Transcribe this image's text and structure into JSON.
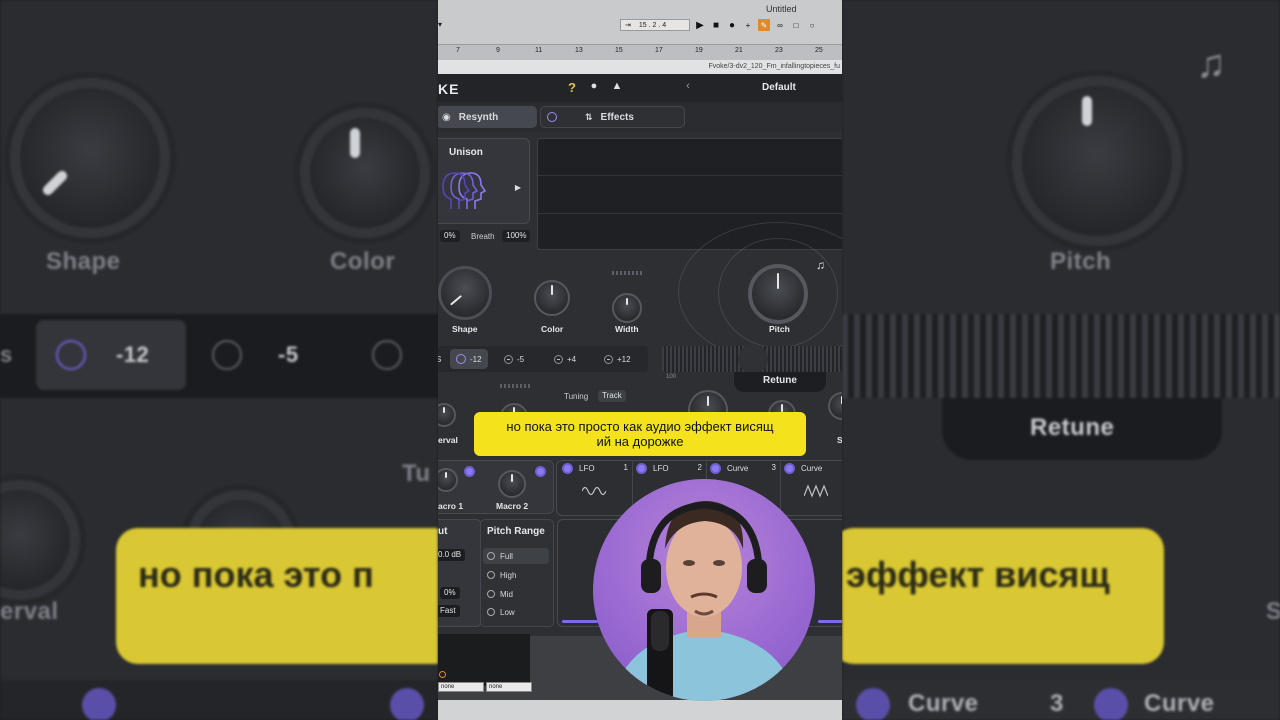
{
  "daw": {
    "title": "Untitled",
    "position": "15 . 2 . 4",
    "ruler_marks": [
      "7",
      "9",
      "11",
      "13",
      "15",
      "17",
      "19",
      "21",
      "23",
      "25"
    ],
    "file_path": "Fvoke/3-dv2_120_Fm_infallingtopieces_fu"
  },
  "plugin": {
    "logo": "KE",
    "help": "?",
    "preset": "Default",
    "tabs": {
      "resynth": "Resynth",
      "effects": "Effects"
    },
    "unison": {
      "title": "Unison",
      "value_left": "0%",
      "breath_label": "Breath",
      "breath_value": "100%"
    },
    "knobs": {
      "shape": "Shape",
      "color": "Color",
      "width": "Width",
      "pitch": "Pitch"
    },
    "intervals": {
      "sel": "-12",
      "i2": "-5",
      "i3": "+4",
      "i4": "+12"
    },
    "tuning_label": "Tuning",
    "tuning_value": "Track",
    "retune": "Retune",
    "slider_min": "100",
    "interval_partial": "erval",
    "s_partial": "S",
    "macros": {
      "m1": "acro 1",
      "m2": "Macro 2"
    },
    "mod_slots": [
      {
        "name": "LFO",
        "num": "1"
      },
      {
        "name": "LFO",
        "num": "2"
      },
      {
        "name": "Curve",
        "num": "3"
      },
      {
        "name": "Curve",
        "num": ""
      }
    ],
    "left_partial": {
      "ut": "ut",
      "db": "0.0 dB",
      "pct": "0%",
      "fast": "Fast"
    },
    "pitch_range": {
      "title": "Pitch Range",
      "options": [
        "Full",
        "High",
        "Mid",
        "Low"
      ],
      "selected": "Full"
    },
    "bottom_selects": [
      "none",
      "none"
    ]
  },
  "subtitle": {
    "line1": "но пока это просто как аудио эффект висящ",
    "line2": "ий на дорожке"
  },
  "background": {
    "left": {
      "shape": "Shape",
      "color": "Color",
      "interval_neg12": "-12",
      "interval_neg5": "-5",
      "s": "s",
      "tu": "Tu",
      "erval": "erval",
      "yellow": "но пока это п"
    },
    "right": {
      "pitch": "Pitch",
      "retune": "Retune",
      "yellow": "эффект висящ",
      "curve": "Curve",
      "curve_num": "3",
      "curve2": "Curve",
      "s": "S"
    }
  },
  "colors": {
    "accent": "#8a7af2",
    "subtitle_bg": "#f3e21c",
    "help": "#e3c23e"
  }
}
